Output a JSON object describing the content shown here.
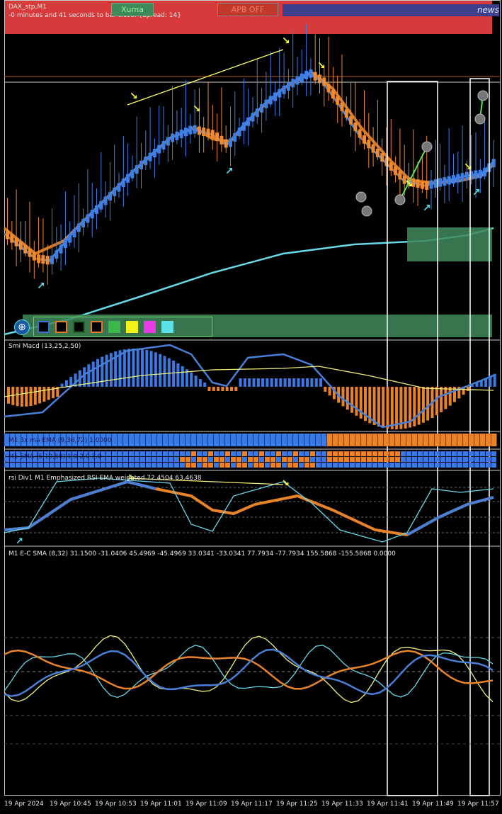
{
  "window": {
    "symbol": "DAX_stp,M1",
    "bar_timer": "-0 minutes and 41 seconds to bar close. {Spread: 14}"
  },
  "top_buttons": {
    "xuma": "Xuma",
    "apb": "APB OFF",
    "news": "news"
  },
  "indicators": {
    "macd": "Smi Macd (13,25,2,50)",
    "ma_strip": "M1 3x ma EMA (9,36,72) 1.0000",
    "ema_strip": "M1 EMA (5,10,50) 1.0 2.0 3.0",
    "rsi": "rsi Div1 M1 Emphasized RSI EMA weighted  72.4504 63.4638",
    "ec": "M1 E-C SMA (8,32) 31.1500 -31.0406 45.4969 -45.4969 33.0341 -33.0341 77.7934 -77.7934 155.5868 -155.5868 0.0000"
  },
  "time_axis": [
    "19 Apr 2024",
    "19 Apr 10:45",
    "19 Apr 10:53",
    "19 Apr 11:01",
    "19 Apr 11:09",
    "19 Apr 11:17",
    "19 Apr 11:25",
    "19 Apr 11:33",
    "19 Apr 11:41",
    "19 Apr 11:49",
    "19 Apr 11:57"
  ],
  "palette": [
    "#3b6fd8",
    "#e07c2c",
    "#1f6b1f",
    "#e07c2c",
    "#3cb84a",
    "#f2f21a",
    "#e83ce8",
    "#5de0e6"
  ],
  "colors": {
    "bull": "#3b78e0",
    "bear": "#e8832a",
    "cyan": "#69d8e8",
    "yellow": "#f0f07a",
    "banner_red": "#d63a3a",
    "zone_green": "#3f8a5a"
  }
}
